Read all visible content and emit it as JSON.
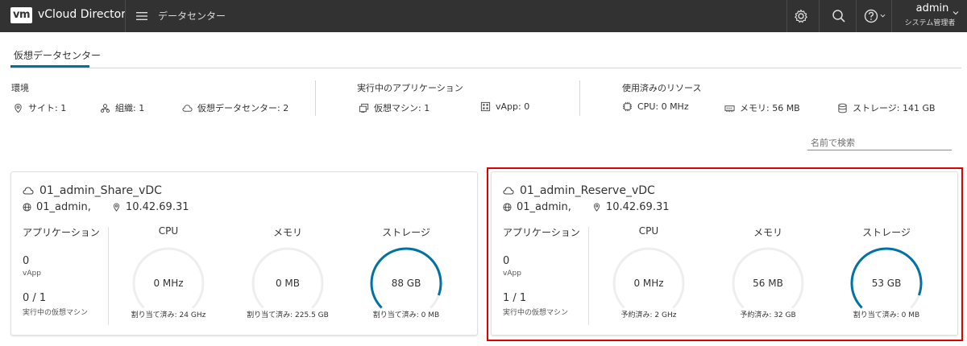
{
  "header": {
    "logo": "vm",
    "app_title": "vCloud Director",
    "nav_label": "データセンター",
    "user_name": "admin",
    "user_role": "システム管理者"
  },
  "tab": {
    "label": "仮想データセンター"
  },
  "summary": {
    "environment": {
      "title": "環境",
      "site": "サイト: 1",
      "org": "組織: 1",
      "vdc": "仮想データセンター: 2"
    },
    "running_apps": {
      "title": "実行中のアプリケーション",
      "vm": "仮想マシン: 1",
      "vapp": "vApp: 0"
    },
    "resources": {
      "title": "使用済みのリソース",
      "cpu": "CPU: 0 MHz",
      "memory": "メモリ: 56 MB",
      "storage": "ストレージ: 141 GB"
    }
  },
  "search": {
    "placeholder": "名前で検索"
  },
  "cards": [
    {
      "name": "01_admin_Share_vDC",
      "org": "01_admin,",
      "ip": "10.42.69.31",
      "apps_heading": "アプリケーション",
      "vapp_count": "0",
      "vapp_label": "vApp",
      "vm_count": "0 / 1",
      "vm_label": "実行中の仮想マシン",
      "gauges": [
        {
          "title": "CPU",
          "value": "0 MHz",
          "sub": "割り当て済み: 24 GHz",
          "fraction": 0
        },
        {
          "title": "メモリ",
          "value": "0 MB",
          "sub": "割り当て済み: 225.5 GB",
          "fraction": 0
        },
        {
          "title": "ストレージ",
          "value": "88 GB",
          "sub": "割り当て済み: 0 MB",
          "fraction": 0.68
        }
      ]
    },
    {
      "name": "01_admin_Reserve_vDC",
      "org": "01_admin,",
      "ip": "10.42.69.31",
      "apps_heading": "アプリケーション",
      "vapp_count": "0",
      "vapp_label": "vApp",
      "vm_count": "1 / 1",
      "vm_label": "実行中の仮想マシン",
      "gauges": [
        {
          "title": "CPU",
          "value": "0 MHz",
          "sub": "予約済み: 2 GHz",
          "fraction": 0
        },
        {
          "title": "メモリ",
          "value": "56 MB",
          "sub": "予約済み: 32 GB",
          "fraction": 0
        },
        {
          "title": "ストレージ",
          "value": "53 GB",
          "sub": "割り当て済み: 0 MB",
          "fraction": 0.68
        }
      ]
    }
  ],
  "colors": {
    "accent": "#0072a3",
    "highlight": "#e00000",
    "header_bg": "#323232",
    "gauge_track": "#eeeeee"
  }
}
